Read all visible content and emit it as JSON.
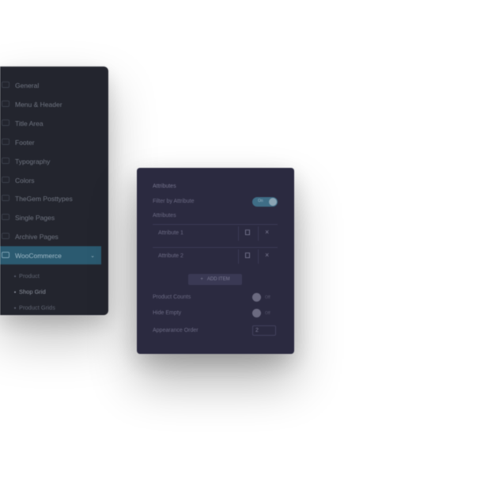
{
  "sidebar": {
    "items": [
      {
        "label": "General",
        "icon": "gear-icon"
      },
      {
        "label": "Menu & Header",
        "icon": "menu-icon"
      },
      {
        "label": "Title Area",
        "icon": "title-icon"
      },
      {
        "label": "Footer",
        "icon": "footer-icon"
      },
      {
        "label": "Typography",
        "icon": "typography-icon"
      },
      {
        "label": "Colors",
        "icon": "palette-icon"
      },
      {
        "label": "TheGem Posttypes",
        "icon": "posttypes-icon"
      },
      {
        "label": "Single Pages",
        "icon": "page-icon"
      },
      {
        "label": "Archive Pages",
        "icon": "archive-icon"
      },
      {
        "label": "WooCommerce",
        "icon": "cart-icon"
      }
    ],
    "active_chevron": "⌄",
    "sub_items": [
      {
        "label": "Product"
      },
      {
        "label": "Shop Grid"
      },
      {
        "label": "Product Grids"
      }
    ],
    "accent_color": "#2b5a70"
  },
  "panel": {
    "section_title": "Attributes",
    "filter_label": "Filter by Attribute",
    "filter_toggle_text": "On",
    "attributes_label": "Attributes",
    "attributes": [
      {
        "name": "Attribute 1"
      },
      {
        "name": "Attribute 2"
      }
    ],
    "close_glyph": "×",
    "add_plus": "+",
    "add_label": "ADD ITEM",
    "product_counts_label": "Product Counts",
    "product_counts_toggle": "Off",
    "hide_empty_label": "Hide Empty",
    "hide_empty_toggle": "Off",
    "order_label": "Appearance Order",
    "order_value": "2"
  }
}
